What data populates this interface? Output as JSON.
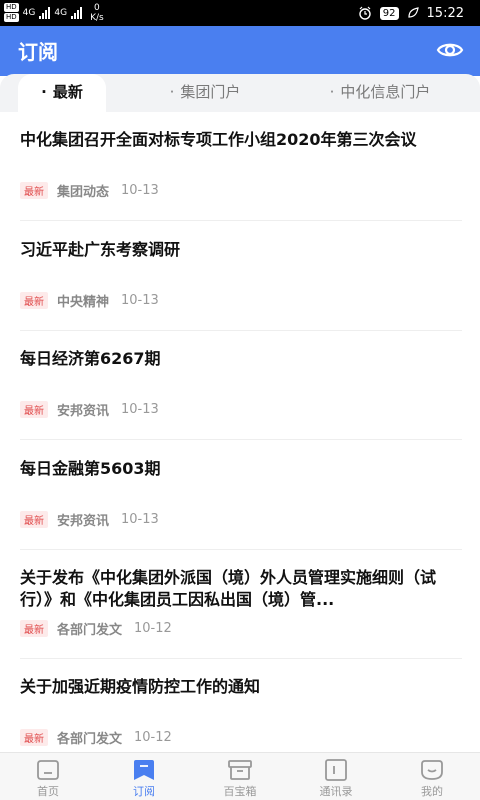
{
  "status_bar": {
    "hd1": "HD",
    "hd2": "HD",
    "net1": "4G",
    "net2": "4G",
    "speed_value": "0",
    "speed_unit": "K/s",
    "battery": "92",
    "time": "15:22"
  },
  "header": {
    "title": "订阅"
  },
  "tabs": [
    {
      "label": "最新"
    },
    {
      "label": "集团门户"
    },
    {
      "label": "中化信息门户"
    }
  ],
  "tab_dot": "·",
  "articles": [
    {
      "title": "中化集团召开全面对标专项工作小组2020年第三次会议",
      "badge": "最新",
      "source": "集团动态",
      "date": "10-13"
    },
    {
      "title": "习近平赴广东考察调研",
      "badge": "最新",
      "source": "中央精神",
      "date": "10-13"
    },
    {
      "title": "每日经济第6267期",
      "badge": "最新",
      "source": "安邦资讯",
      "date": "10-13"
    },
    {
      "title": "每日金融第5603期",
      "badge": "最新",
      "source": "安邦资讯",
      "date": "10-13"
    },
    {
      "title": "关于发布《中化集团外派国（境）外人员管理实施细则（试行）》和《中化集团员工因私出国（境）管...",
      "badge": "最新",
      "source": "各部门发文",
      "date": "10-12"
    },
    {
      "title": "关于加强近期疫情防控工作的通知",
      "badge": "最新",
      "source": "各部门发文",
      "date": "10-12"
    }
  ],
  "bottom_nav": [
    {
      "label": "首页",
      "icon": "home-icon"
    },
    {
      "label": "订阅",
      "icon": "bookmark-icon"
    },
    {
      "label": "百宝箱",
      "icon": "toolbox-icon"
    },
    {
      "label": "通讯录",
      "icon": "contacts-icon"
    },
    {
      "label": "我的",
      "icon": "profile-icon"
    }
  ],
  "colors": {
    "accent": "#4a7ff0",
    "badge_bg": "#fdeaea",
    "badge_text": "#e0494a"
  }
}
